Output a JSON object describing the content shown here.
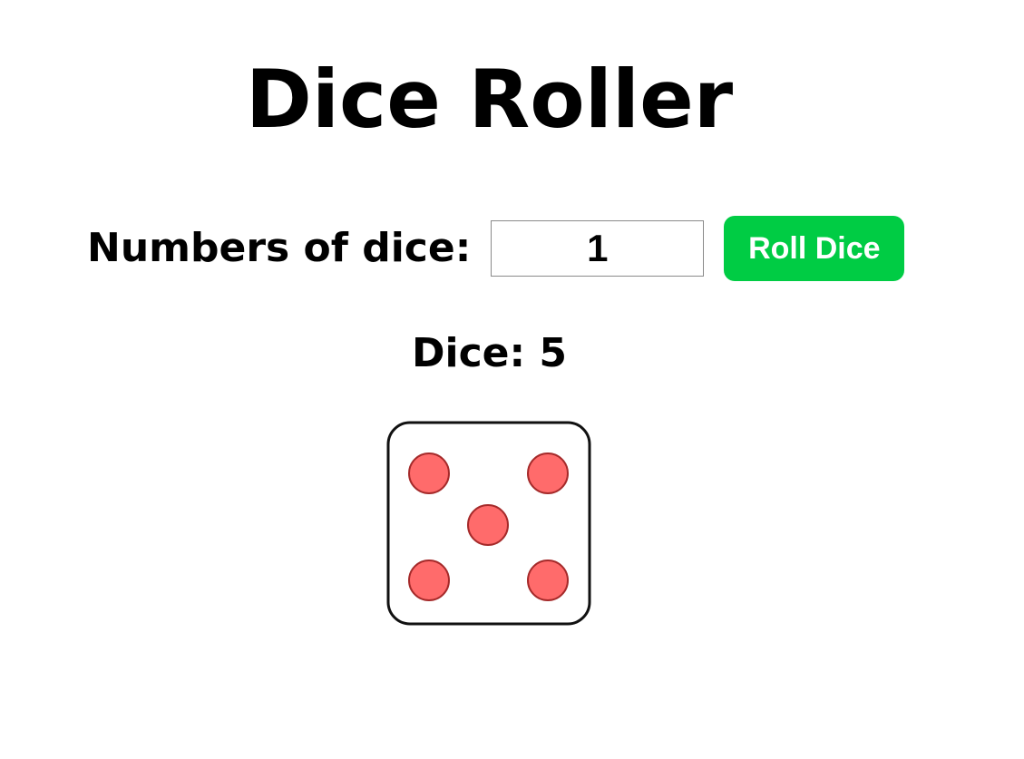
{
  "page": {
    "title": "Dice Roller"
  },
  "controls": {
    "label": "Numbers of dice:",
    "input_value": "1",
    "roll_button_label": "Roll Dice"
  },
  "result": {
    "text": "Dice: 5",
    "dice_values": [
      5
    ]
  },
  "colors": {
    "button": "#00cc44",
    "pip_fill": "#ff6b6b",
    "pip_stroke": "#a52a2a",
    "die_border": "#111111"
  }
}
